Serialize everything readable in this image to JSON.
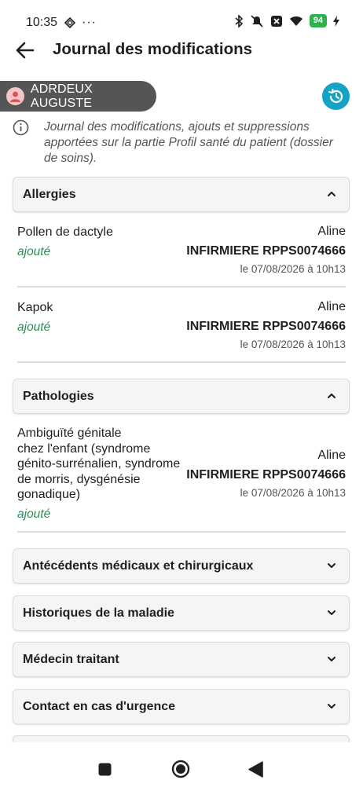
{
  "status_bar": {
    "time": "10:35",
    "battery": "94"
  },
  "header": {
    "title": "Journal des modifications"
  },
  "patient": {
    "name": "ADRDEUX AUGUSTE"
  },
  "info": {
    "text": "Journal des modifications, ajouts et suppressions apportées sur la partie Profil santé du patient (dossier de soins)."
  },
  "sections": {
    "allergies": {
      "title": "Allergies",
      "expanded": true,
      "entries": [
        {
          "name": "Pollen de dactyle",
          "status": "ajouté",
          "author": "Aline",
          "role": "INFIRMIERE RPPS0074666",
          "date": "le 07/08/2026 à 10h13"
        },
        {
          "name": "Kapok",
          "status": "ajouté",
          "author": "Aline",
          "role": "INFIRMIERE RPPS0074666",
          "date": "le 07/08/2026 à 10h13"
        }
      ]
    },
    "pathologies": {
      "title": "Pathologies",
      "expanded": true,
      "entries": [
        {
          "name_lines": [
            "Ambiguïté génitale",
            "chez l'enfant (syndrome",
            "génito-surrénalien, syndrome",
            "de morris, dysgénésie",
            "gonadique)"
          ],
          "status": "ajouté",
          "author": "Aline",
          "role": "INFIRMIERE RPPS0074666",
          "date": "le 07/08/2026 à 10h13"
        }
      ]
    },
    "antecedents": {
      "title": "Antécédents médicaux et chirurgicaux",
      "expanded": false
    },
    "historiques": {
      "title": "Historiques de la maladie",
      "expanded": false
    },
    "medecin": {
      "title": "Médecin traitant",
      "expanded": false
    },
    "contact": {
      "title": "Contact en cas d'urgence",
      "expanded": false
    }
  },
  "colors": {
    "accent": "#14a3c4",
    "status_added": "#2e8b57",
    "chip_bg": "#555555"
  }
}
